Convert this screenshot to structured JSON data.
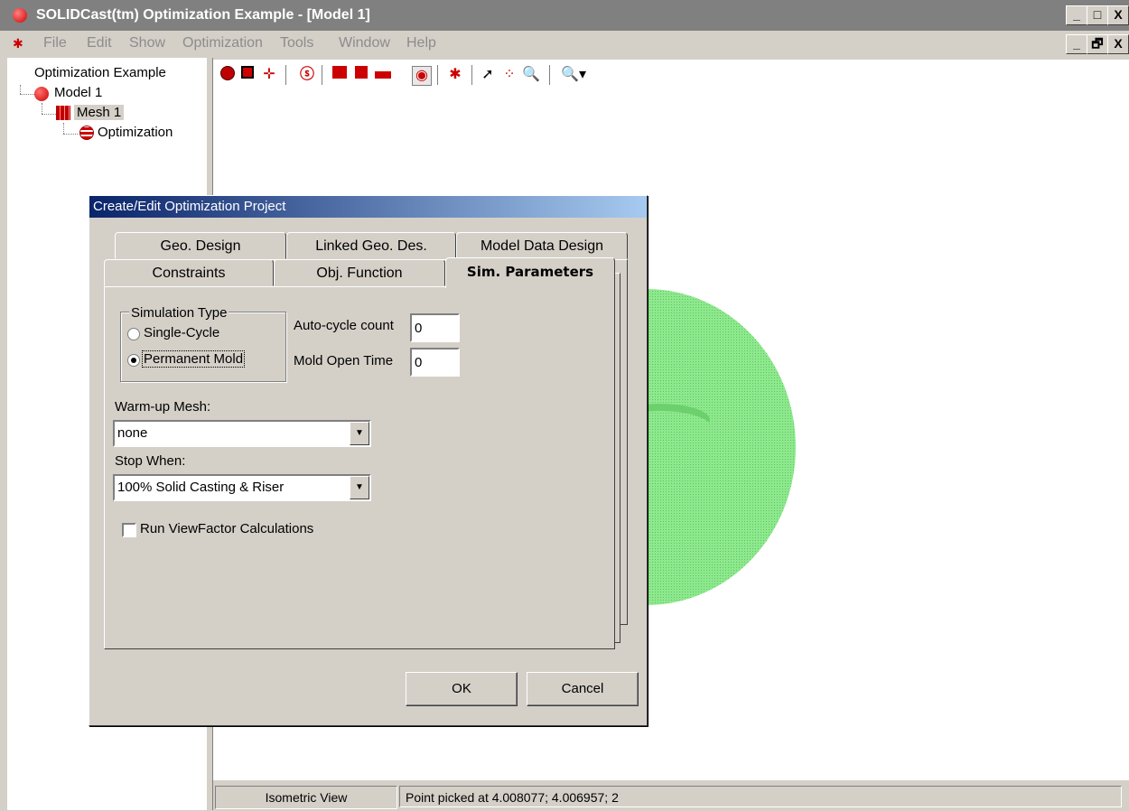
{
  "window": {
    "title": "SOLIDCast(tm) Optimization Example - [Model 1]",
    "controls": [
      "_",
      "□",
      "X"
    ],
    "mdi_controls": [
      "_",
      "🗗",
      "X"
    ]
  },
  "menu": {
    "items": [
      "File",
      "Edit",
      "Show",
      "Optimization",
      "Tools",
      "Window",
      "Help"
    ]
  },
  "tree": {
    "root": "Optimization Example",
    "model": "Model 1",
    "mesh": "Mesh 1",
    "optimization": "Optimization"
  },
  "toolbar": {
    "icons": [
      "sphere-icon",
      "red-square-icon",
      "crosshair-icon",
      "s-icon",
      "xz-icon",
      "y-icon",
      "xy-icon",
      "rotate-icon",
      "star-icon",
      "cursor-icon",
      "node-icon",
      "zoom-icon",
      "zoom-dropdown-icon"
    ]
  },
  "dialog": {
    "title": "Create/Edit Optimization Project",
    "tabs_back": [
      "Geo. Design",
      "Linked Geo. Des.",
      "Model Data Design"
    ],
    "tabs_front": [
      "Constraints",
      "Obj. Function",
      "Sim. Parameters"
    ],
    "active_tab": "Sim. Parameters",
    "simulation_type": {
      "group_label": "Simulation Type",
      "options": [
        "Single-Cycle",
        "Permanent Mold"
      ],
      "selected": "Permanent Mold"
    },
    "auto_cycle": {
      "label": "Auto-cycle count",
      "value": "0"
    },
    "mold_open": {
      "label": "Mold Open Time",
      "value": "0"
    },
    "warmup_mesh": {
      "label": "Warm-up Mesh:",
      "value": "none"
    },
    "stop_when": {
      "label": "Stop When:",
      "value": "100% Solid Casting & Riser"
    },
    "viewfactor": {
      "label": "Run ViewFactor Calculations",
      "checked": false
    },
    "ok_label": "OK",
    "cancel_label": "Cancel"
  },
  "statusbar": {
    "view": "Isometric View",
    "message": "Point picked at 4.008077; 4.006957; 2"
  },
  "colors": {
    "model_green": "#7fe07f",
    "title_gradient_start": "#0a246a",
    "title_gradient_end": "#a6caf0"
  }
}
